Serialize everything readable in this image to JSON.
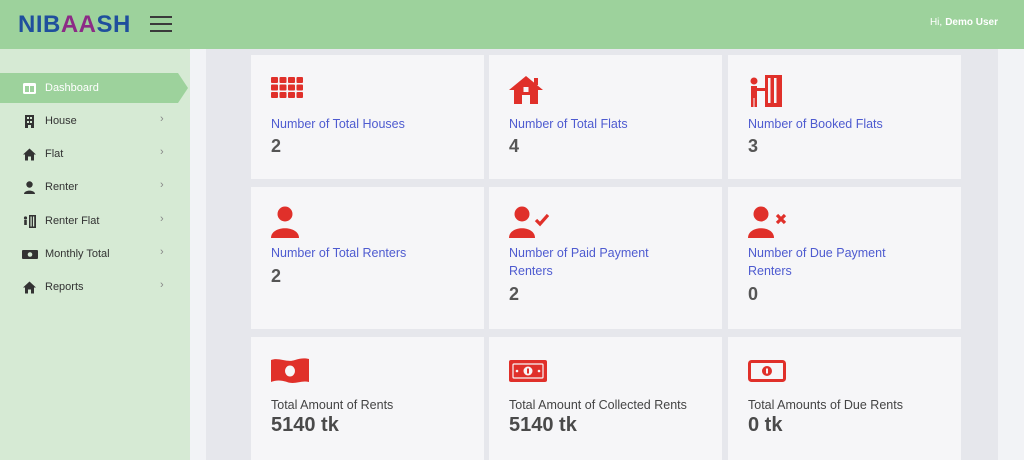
{
  "app": {
    "logo_left": "NIB",
    "logo_mid": "AA",
    "logo_right": "SH"
  },
  "header": {
    "greeting": "Hi,",
    "user": "Demo User"
  },
  "sidebar": {
    "items": [
      {
        "label": "Dashboard",
        "icon": "dashboard-icon",
        "active": true
      },
      {
        "label": "House",
        "icon": "building-icon"
      },
      {
        "label": "Flat",
        "icon": "home-icon"
      },
      {
        "label": "Renter",
        "icon": "user-icon"
      },
      {
        "label": "Renter Flat",
        "icon": "door-icon"
      },
      {
        "label": "Monthly Total",
        "icon": "money-icon"
      },
      {
        "label": "Reports",
        "icon": "home-icon"
      }
    ],
    "chevron": "›"
  },
  "cards": [
    {
      "title": "Number of Total Houses",
      "value": "2",
      "icon": "grid-icon"
    },
    {
      "title": "Number of Total Flats",
      "value": "4",
      "icon": "house-icon"
    },
    {
      "title": "Number of Booked Flats",
      "value": "3",
      "icon": "booked-door-icon"
    },
    {
      "title": "Number of Total Renters",
      "value": "2",
      "icon": "user-icon"
    },
    {
      "title": "Number of Paid Payment Renters",
      "value": "2",
      "icon": "user-check-icon"
    },
    {
      "title": "Number of Due Payment Renters",
      "value": "0",
      "icon": "user-x-icon"
    },
    {
      "title": "Total Amount of Rents",
      "value": "5140 tk",
      "icon": "banknote-icon"
    },
    {
      "title": "Total Amount of Collected Rents",
      "value": "5140 tk",
      "icon": "bill-icon"
    },
    {
      "title": "Total Amounts of Due Rents",
      "value": "0 tk",
      "icon": "bill-outline-icon"
    }
  ],
  "colors": {
    "accent": "#9dd29c",
    "icon": "#e0302a",
    "link": "#4e5bd0"
  }
}
